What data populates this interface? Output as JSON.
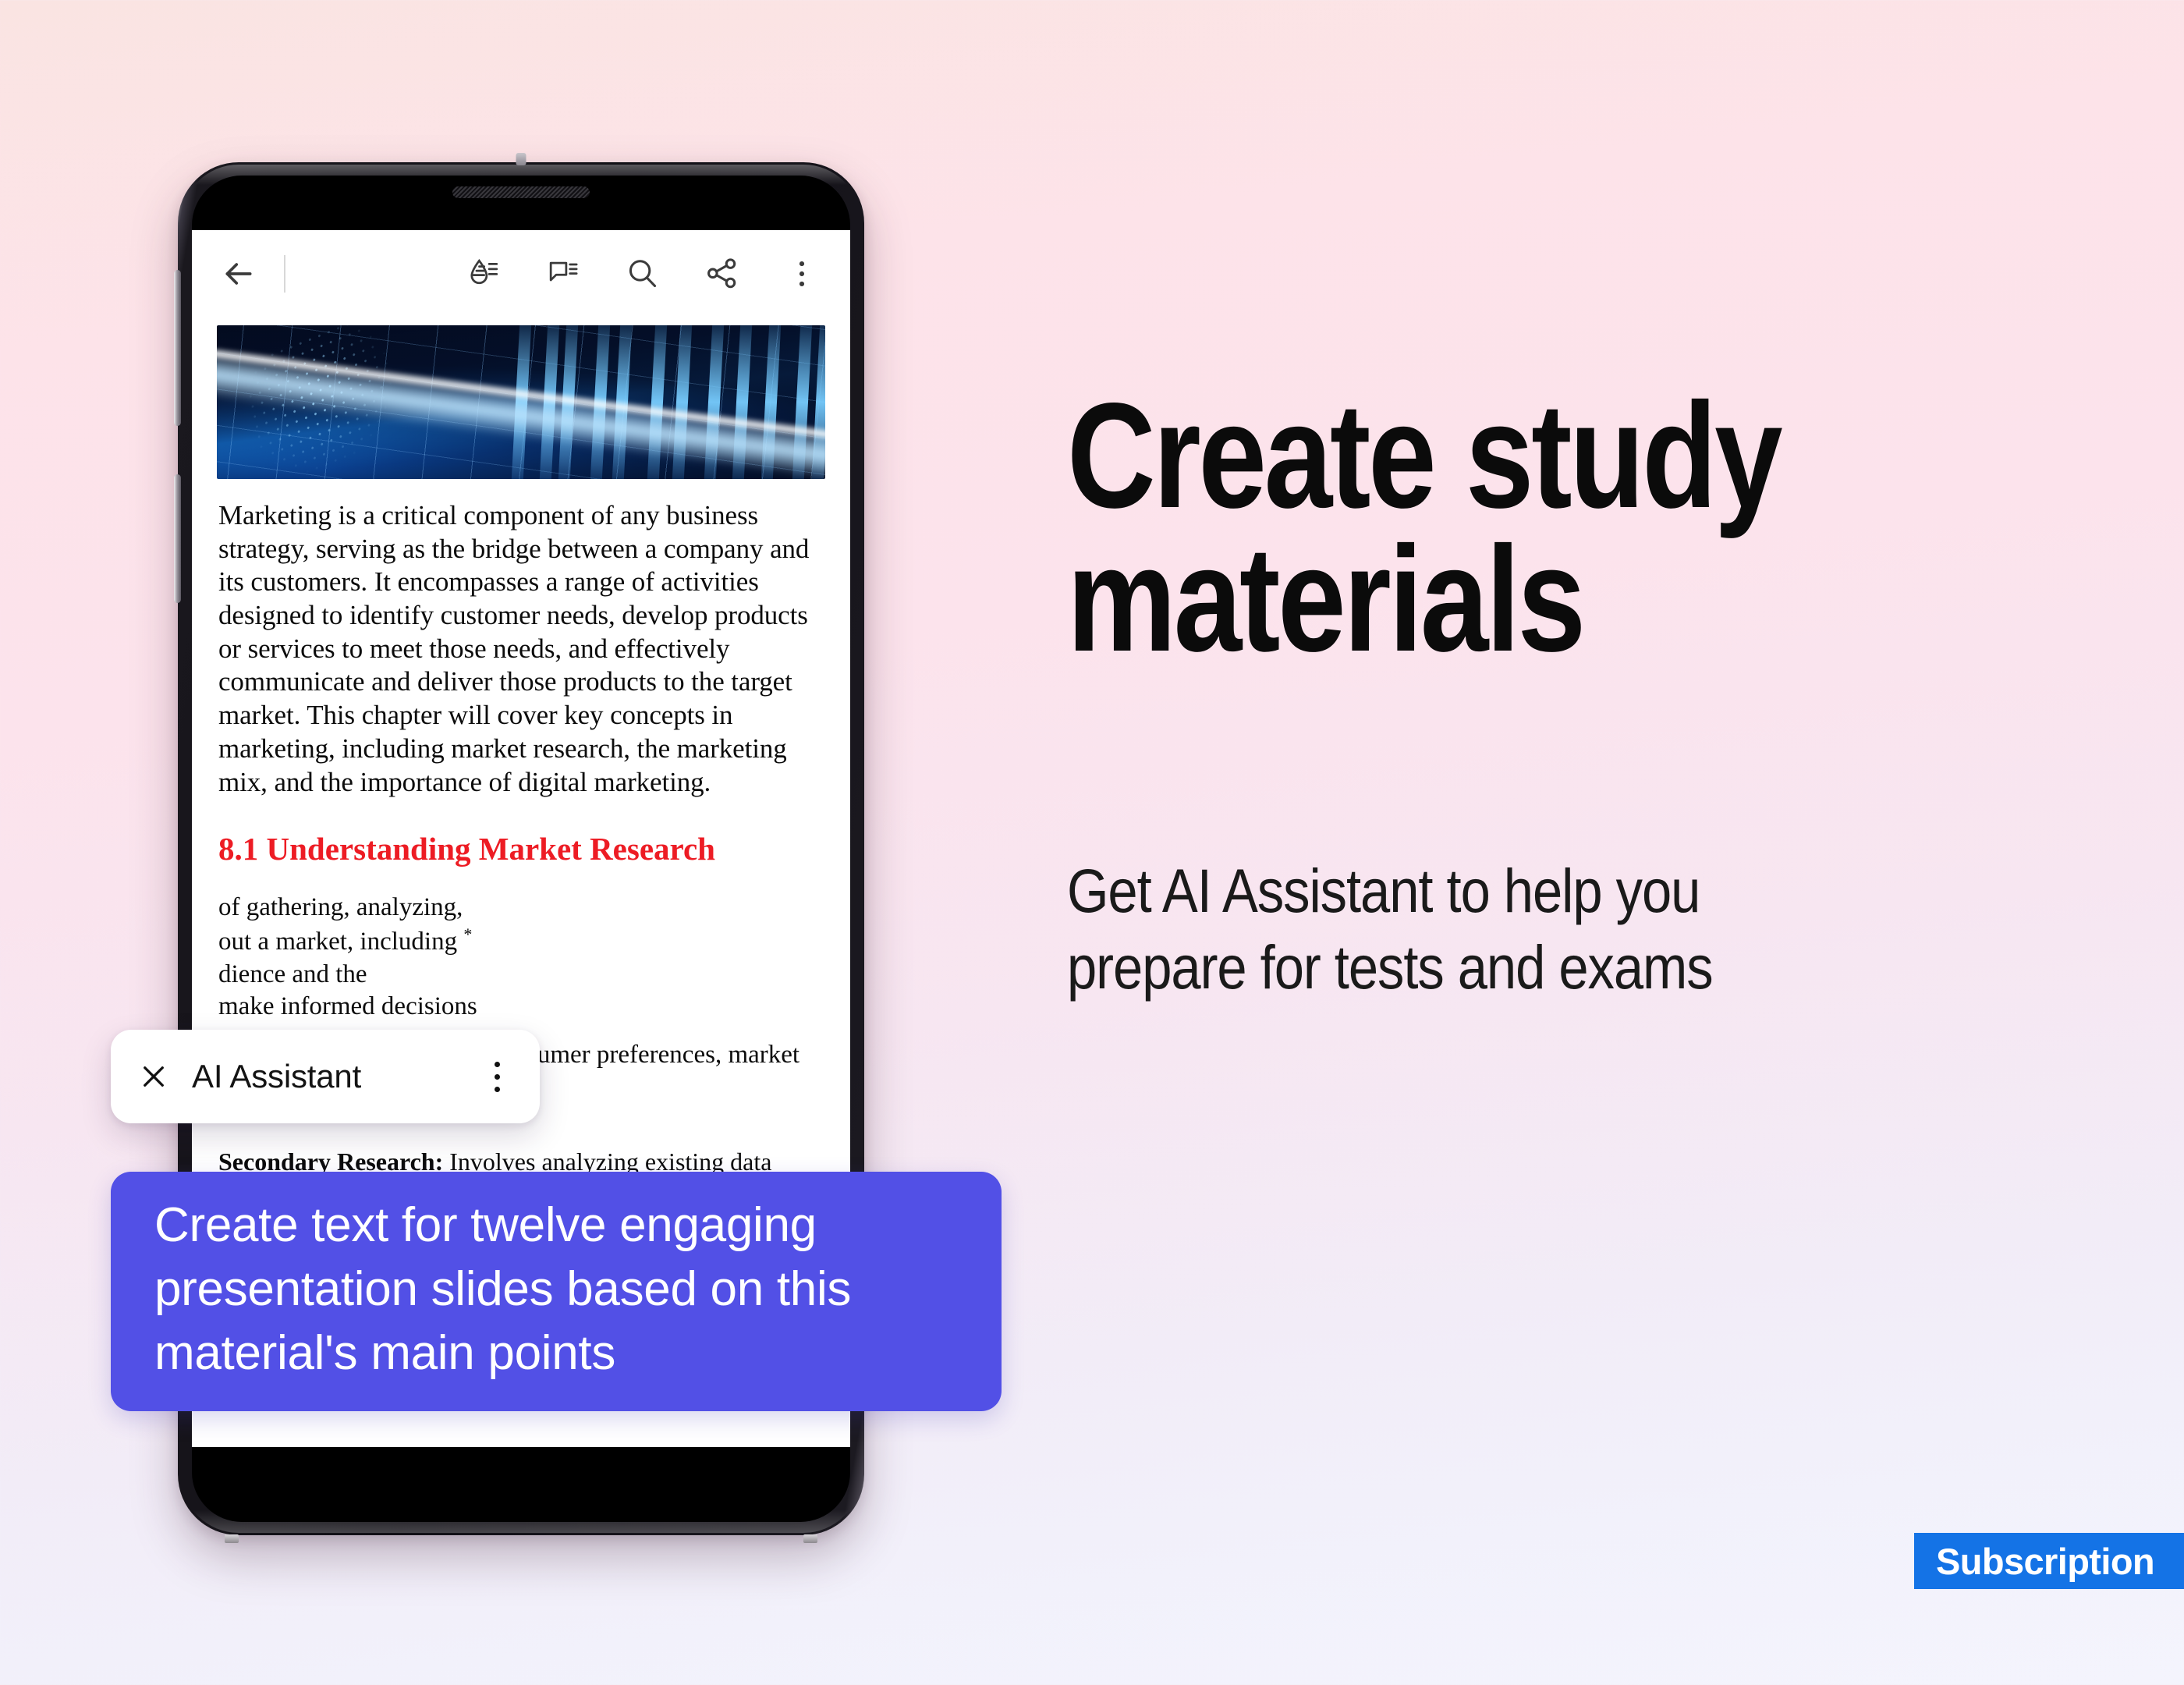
{
  "background": {
    "gradient_top": "#fae4e2",
    "gradient_mid": "#fce3ec",
    "gradient_bottom": "#f4f4fd"
  },
  "promo": {
    "headline_line1": "Create study",
    "headline_line2": "materials",
    "subhead_line1": "Get AI Assistant to help you",
    "subhead_line2": "prepare for tests and exams",
    "badge_label": "Subscription",
    "badge_color": "#1473E6"
  },
  "phone": {
    "toolbar": {
      "back_icon": "back-arrow-icon",
      "icons": [
        {
          "name": "highlight-droplet-icon",
          "label": "Highlight"
        },
        {
          "name": "comment-bubble-icon",
          "label": "Comment"
        },
        {
          "name": "search-icon",
          "label": "Search"
        },
        {
          "name": "share-icon",
          "label": "Share"
        },
        {
          "name": "overflow-menu-icon",
          "label": "More options"
        }
      ]
    },
    "document": {
      "hero_image_alt": "Abstract blue technology bars and grid graphic",
      "paragraph_1": "Marketing is a critical component of any business strategy, serving as the bridge between a company and its customers. It encompasses a range of activities designed to identify customer needs, develop products or services to meet those needs, and effectively communicate and deliver those products to the target market. This chapter will cover key concepts in marketing, including market research, the marketing mix, and the importance of digital marketing.",
      "heading_8_1": "8.1 Understanding Market Research",
      "paragraph_2_visible_a": "of gathering, analyzing,",
      "paragraph_2_visible_b": "out a market, including",
      "paragraph_2_visible_c": "dience and the",
      "paragraph_2_visible_d": "make informed decisions",
      "paragraph_2_footnote_mark": "*",
      "paragraph_3": "by providing insights into consumer preferences, market",
      "secondary_research_label": "Secondary Research:",
      "secondary_research_text": " Involves analyzing existing data from reports, studies, and market analysis."
    },
    "ai_card": {
      "title": "AI Assistant",
      "close_icon": "close-x-icon",
      "menu_icon": "kebab-menu-icon"
    },
    "prompt_bubble": {
      "text": "Create text for twelve engaging presentation slides based on this material's main points",
      "color": "#5250E6"
    }
  }
}
